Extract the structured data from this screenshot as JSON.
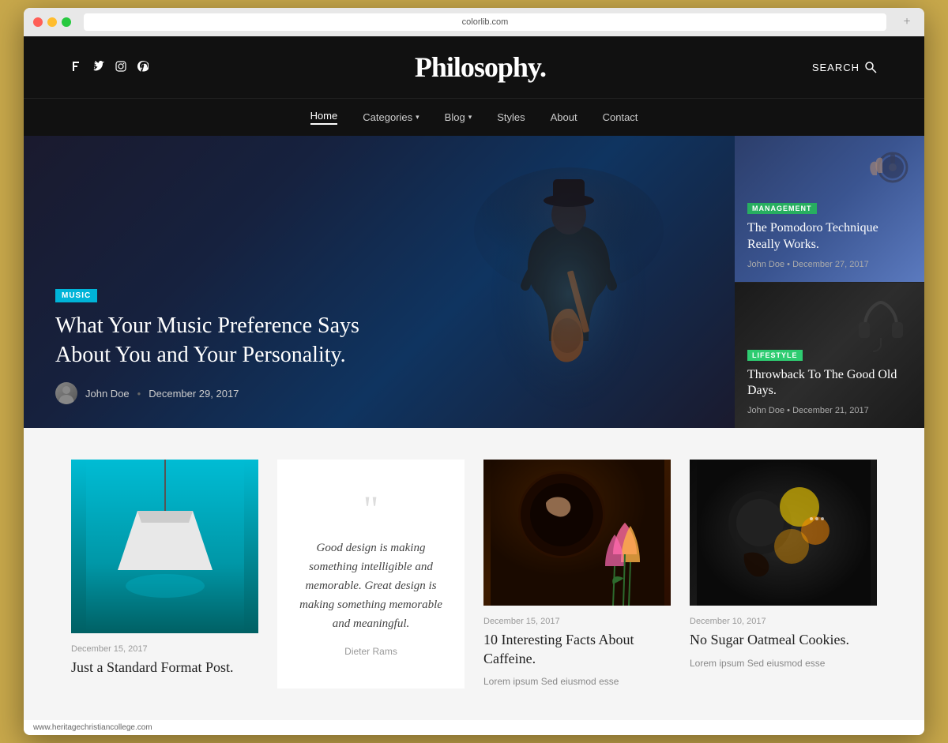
{
  "browser": {
    "address": "colorlib.com",
    "new_tab_label": "+"
  },
  "header": {
    "title": "Philosophy.",
    "search_label": "SEARCH",
    "social_icons": [
      {
        "name": "facebook",
        "symbol": "f"
      },
      {
        "name": "twitter",
        "symbol": "t"
      },
      {
        "name": "instagram",
        "symbol": "i"
      },
      {
        "name": "pinterest",
        "symbol": "p"
      }
    ]
  },
  "nav": {
    "items": [
      {
        "label": "Home",
        "active": true,
        "has_arrow": false
      },
      {
        "label": "Categories",
        "active": false,
        "has_arrow": true
      },
      {
        "label": "Blog",
        "active": false,
        "has_arrow": true
      },
      {
        "label": "Styles",
        "active": false,
        "has_arrow": false
      },
      {
        "label": "About",
        "active": false,
        "has_arrow": false
      },
      {
        "label": "Contact",
        "active": false,
        "has_arrow": false
      }
    ]
  },
  "hero": {
    "badge": "MUSIC",
    "title": "What Your Music Preference Says About You and Your Personality.",
    "author": "John Doe",
    "date": "December 29, 2017",
    "dot_separator": "•"
  },
  "sidebar_cards": [
    {
      "badge": "MANAGEMENT",
      "badge_class": "badge-green",
      "bg_class": "bg-blue",
      "title": "The Pomodoro Technique Really Works.",
      "author": "John Doe",
      "date": "December 27, 2017"
    },
    {
      "badge": "LIFESTYLE",
      "badge_class": "badge-teal",
      "bg_class": "bg-dark",
      "title": "Throwback To The Good Old Days.",
      "author": "John Doe",
      "date": "December 21, 2017"
    }
  ],
  "posts": [
    {
      "type": "image-lamp",
      "date": "December 15, 2017",
      "title": "Just a Standard Format Post.",
      "excerpt": ""
    },
    {
      "type": "quote",
      "quote_text": "Good design is making something intelligible and memorable. Great design is making something memorable and meaningful.",
      "quote_author": "Dieter Rams"
    },
    {
      "type": "image-coffee",
      "date": "December 15, 2017",
      "title": "10 Interesting Facts About Caffeine.",
      "excerpt": "Lorem ipsum Sed eiusmod esse"
    },
    {
      "type": "image-dark",
      "date": "December 10, 2017",
      "title": "No Sugar Oatmeal Cookies.",
      "excerpt": "Lorem ipsum Sed eiusmod esse"
    }
  ],
  "footer": {
    "url": "www.heritagechristiancollege.com"
  }
}
